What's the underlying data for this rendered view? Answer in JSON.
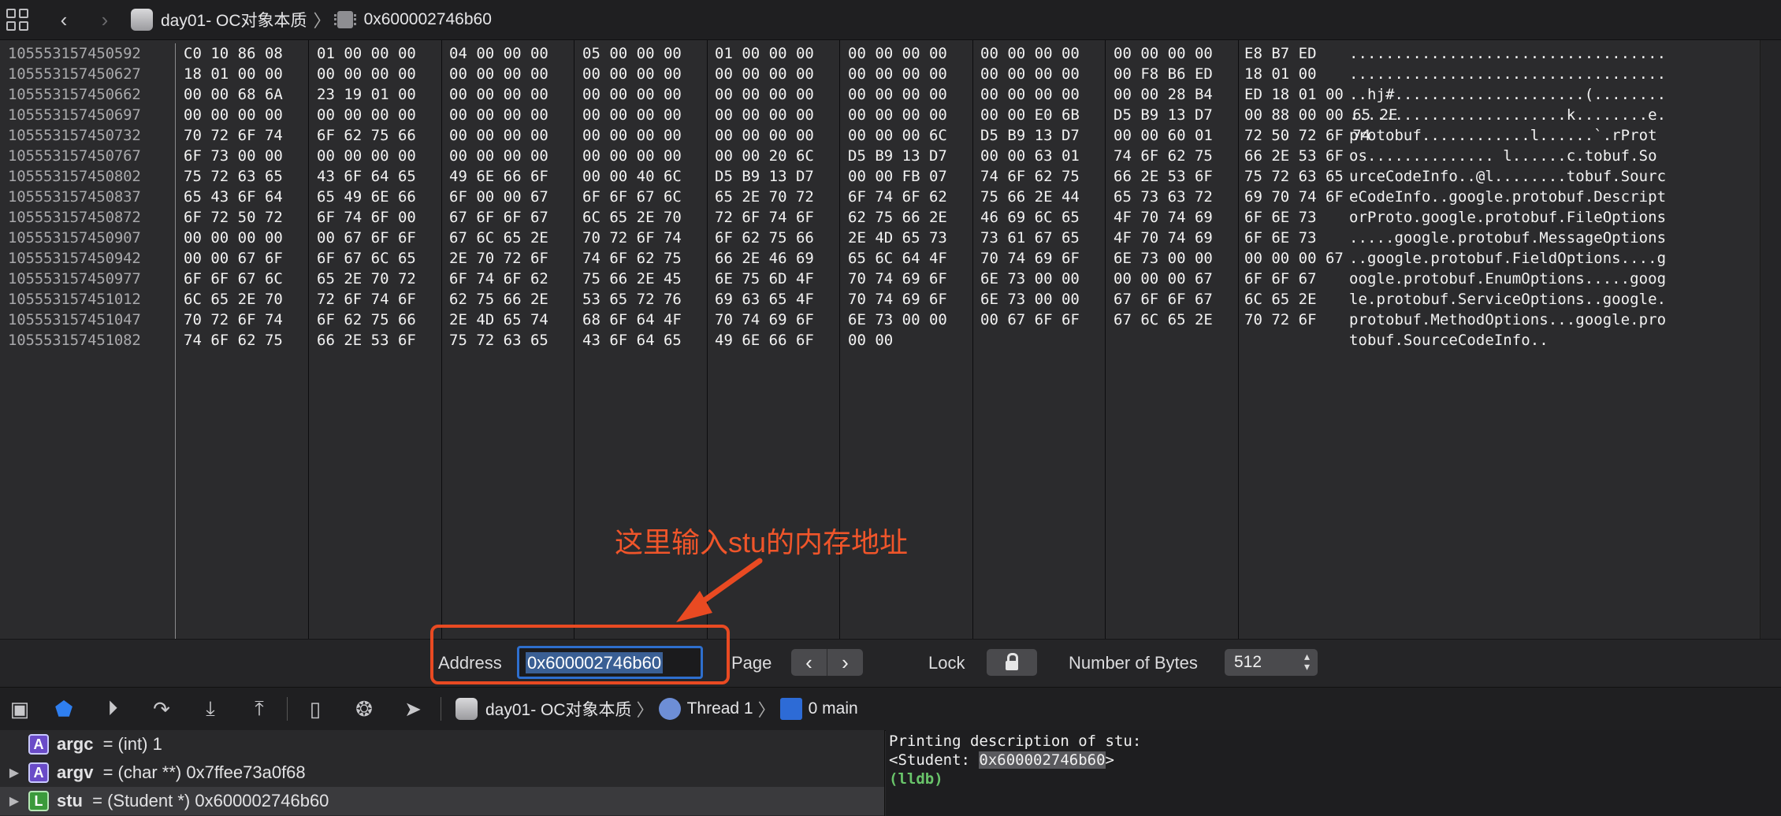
{
  "jumpbar": {
    "project": "day01- OC对象本质",
    "address": "0x600002746b60"
  },
  "memory": {
    "addresses": [
      "105553157450592",
      "105553157450627",
      "105553157450662",
      "105553157450697",
      "105553157450732",
      "105553157450767",
      "105553157450802",
      "105553157450837",
      "105553157450872",
      "105553157450907",
      "105553157450942",
      "105553157450977",
      "105553157451012",
      "105553157451047",
      "105553157451082"
    ],
    "hex_groups": [
      [
        "C0 10 86 08",
        "18 01 00 00",
        "00 00 68 6A",
        "00 00 00 00",
        "70 72 6F 74",
        "6F 73 00 00",
        "75 72 63 65",
        "65 43 6F 64",
        "6F 72 50 72",
        "00 00 00 00",
        "00 00 67 6F",
        "6F 6F 67 6C",
        "6C 65 2E 70",
        "70 72 6F 74",
        "74 6F 62 75"
      ],
      [
        "01 00 00 00",
        "00 00 00 00",
        "23 19 01 00",
        "00 00 00 00",
        "6F 62 75 66",
        "00 00 00 00",
        "43 6F 64 65",
        "65 49 6E 66",
        "6F 74 6F 00",
        "00 67 6F 6F",
        "6F 67 6C 65",
        "65 2E 70 72",
        "72 6F 74 6F",
        "6F 62 75 66",
        "66 2E 53 6F"
      ],
      [
        "04 00 00 00",
        "00 00 00 00",
        "00 00 00 00",
        "00 00 00 00",
        "00 00 00 00",
        "00 00 00 00",
        "49 6E 66 6F",
        "6F 00 00 67",
        "67 6F 6F 67",
        "67 6C 65 2E",
        "2E 70 72 6F",
        "6F 74 6F 62",
        "62 75 66 2E",
        "2E 4D 65 74",
        "75 72 63 65"
      ],
      [
        "05 00 00 00",
        "00 00 00 00",
        "00 00 00 00",
        "00 00 00 00",
        "00 00 00 00",
        "00 00 00 00",
        "00 00 40 6C",
        "6F 6F 67 6C",
        "6C 65 2E 70",
        "70 72 6F 74",
        "74 6F 62 75",
        "75 66 2E 45",
        "53 65 72 76",
        "68 6F 64 4F",
        "43 6F 64 65"
      ],
      [
        "01 00 00 00",
        "00 00 00 00",
        "00 00 00 00",
        "00 00 00 00",
        "00 00 00 00",
        "00 00 20 6C",
        "D5 B9 13 D7",
        "65 2E 70 72",
        "72 6F 74 6F",
        "6F 62 75 66",
        "66 2E 46 69",
        "6E 75 6D 4F",
        "69 63 65 4F",
        "70 74 69 6F",
        "49 6E 66 6F"
      ],
      [
        "00 00 00 00",
        "00 00 00 00",
        "00 00 00 00",
        "00 00 00 00",
        "00 00 00 6C",
        "D5 B9 13 D7",
        "00 00 FB 07",
        "6F 74 6F 62",
        "62 75 66 2E",
        "2E 4D 65 73",
        "65 6C 64 4F",
        "70 74 69 6F",
        "70 74 69 6F",
        "6E 73 00 00",
        "00 00"
      ],
      [
        "00 00 00 00",
        "00 00 00 00",
        "00 00 00 00",
        "00 00 E0 6B",
        "D5 B9 13 D7",
        "00 00 63 01",
        "74 6F 62 75",
        "75 66 2E 44",
        "46 69 6C 65",
        "73 61 67 65",
        "70 74 69 6F",
        "6E 73 00 00",
        "6E 73 00 00",
        "00 67 6F 6F",
        ""
      ],
      [
        "00 00 00 00",
        "00 F8 B6 ED",
        "00 00 28 B4",
        "D5 B9 13 D7",
        "00 00 60 01",
        "74 6F 62 75",
        "66 2E 53 6F",
        "65 73 63 72",
        "4F 70 74 69",
        "4F 70 74 69",
        "6E 73 00 00",
        "00 00 00 67",
        "67 6F 6F 67",
        "67 6C 65 2E",
        ""
      ],
      [
        "E8 B7 ED",
        "18 01 00",
        "ED 18 01 00",
        "00 88 00 00 65 2E",
        "72 50 72 6F 74",
        "66 2E 53 6F",
        "75 72 63 65",
        "69 70 74 6F",
        "6F 6E 73",
        "6F 6E 73",
        "00 00 00 67",
        "6F 6F 67",
        "6C 65 2E",
        "70 72 6F",
        ""
      ]
    ],
    "ascii": [
      "...................................",
      "...................................",
      "..hj#.....................(........",
      "........................k........e.",
      "protobuf............l......`.rProt",
      "os.............. l......c.tobuf.So",
      "urceCodeInfo..@l........tobuf.Sourc",
      "eCodeInfo..google.protobuf.Descript",
      "orProto.google.protobuf.FileOptions",
      ".....google.protobuf.MessageOptions",
      "..google.protobuf.FieldOptions....g",
      "oogle.protobuf.EnumOptions.....goog",
      "le.protobuf.ServiceOptions..google.",
      "protobuf.MethodOptions...google.pro",
      "tobuf.SourceCodeInfo.."
    ]
  },
  "controls": {
    "address_label": "Address",
    "address_value": "0x600002746b60",
    "page_label": "Page",
    "lock_label": "Lock",
    "bytes_label": "Number of Bytes",
    "bytes_value": "512"
  },
  "annotation": {
    "text": "这里输入stu的内存地址",
    "color": "#e94a22"
  },
  "debugbar": {
    "project": "day01- OC对象本质",
    "thread": "Thread 1",
    "frame": "0 main"
  },
  "variables": [
    {
      "badge": "A",
      "name": "argc",
      "type": " = (int) ",
      "value": "1"
    },
    {
      "badge": "A",
      "name": "argv",
      "type": " = (char **) ",
      "value": "0x7ffee73a0f68"
    },
    {
      "badge": "L",
      "name": "stu",
      "type": " = (Student *) ",
      "value": "0x600002746b60"
    }
  ],
  "console": {
    "line1": "Printing description of stu:",
    "line2_prefix": "<Student: ",
    "line2_addr": "0x600002746b60",
    "line2_suffix": ">",
    "prompt": "(lldb)"
  }
}
